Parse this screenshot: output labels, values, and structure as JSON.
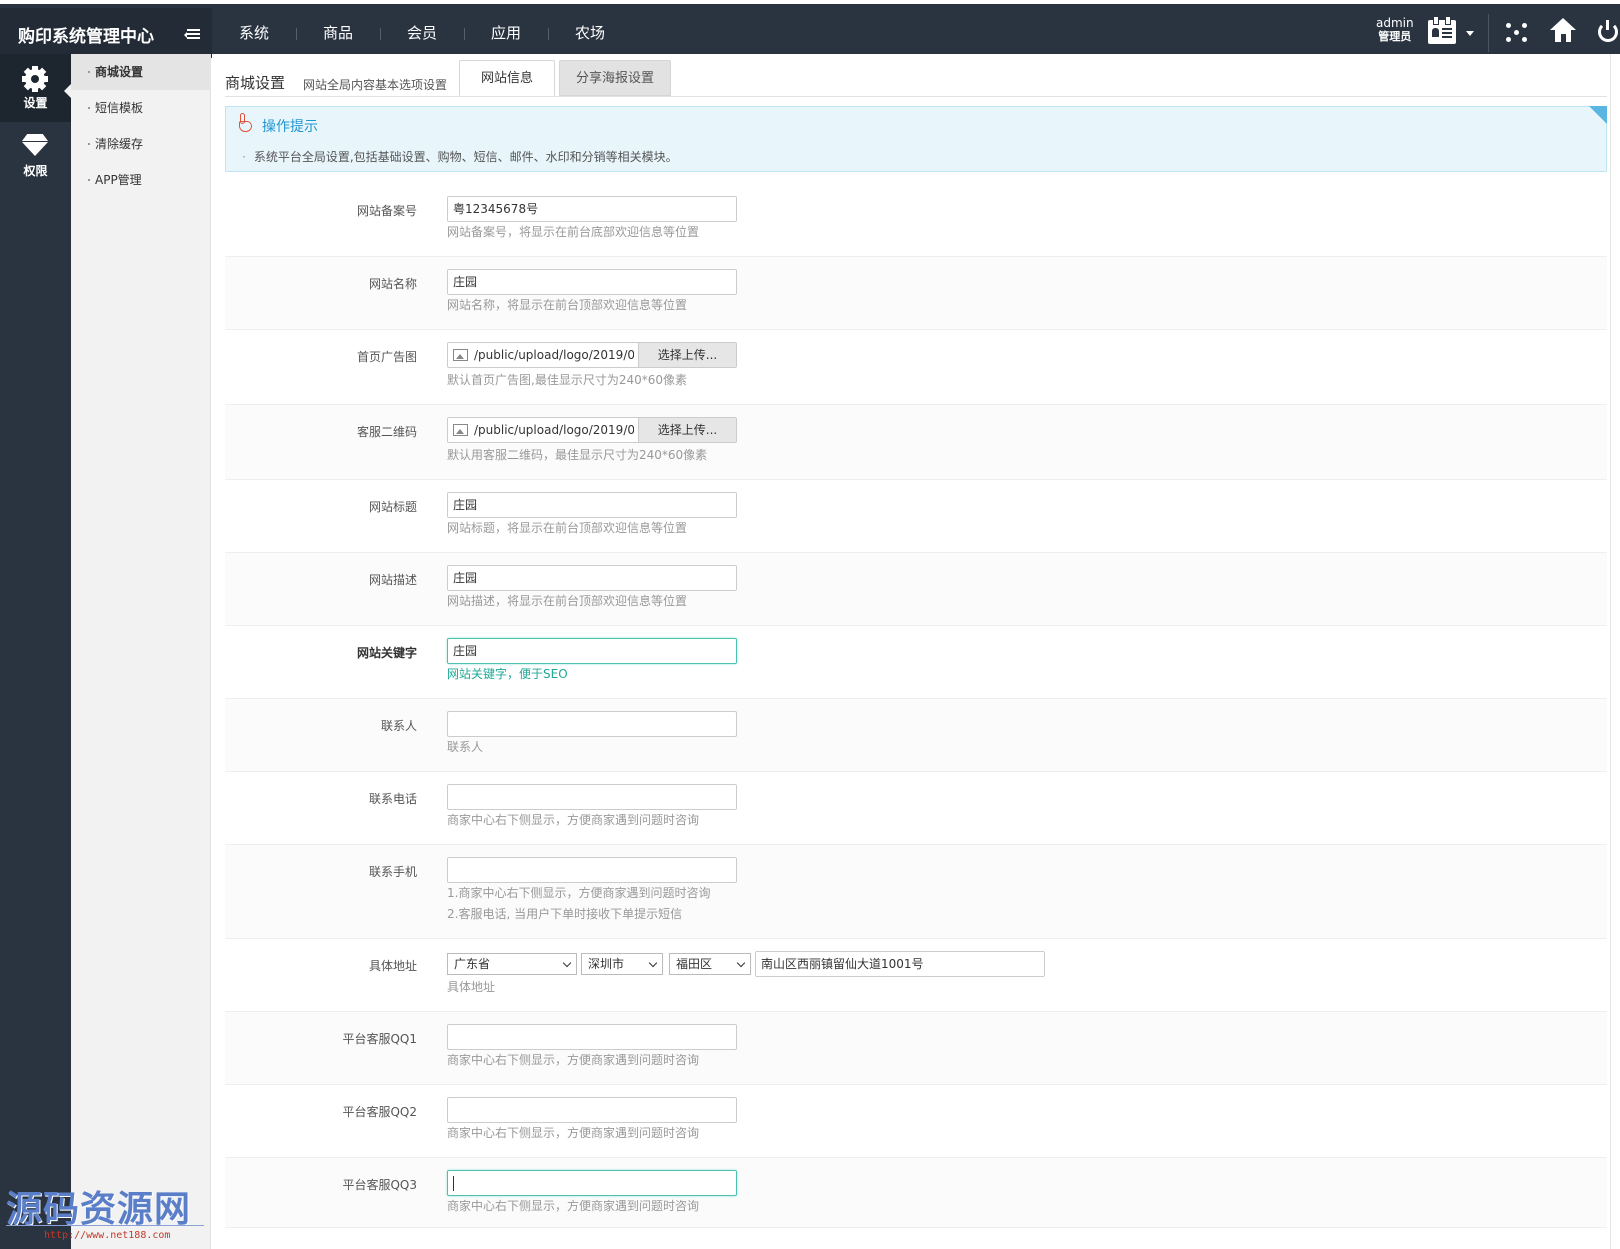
{
  "header": {
    "brand": "购印系统管理中心",
    "nav": [
      "系统",
      "商品",
      "会员",
      "应用",
      "农场"
    ],
    "user_name": "admin",
    "user_role": "管理员"
  },
  "sidebar": {
    "items": [
      {
        "label": "设置",
        "icon": "gear-icon",
        "active": true
      },
      {
        "label": "权限",
        "icon": "diamond-icon",
        "active": false
      }
    ]
  },
  "submenu": {
    "items": [
      "商城设置",
      "短信模板",
      "清除缓存",
      "APP管理"
    ],
    "active": 0
  },
  "page": {
    "title": "商城设置",
    "subtitle": "网站全局内容基本选项设置",
    "tabs": [
      "网站信息",
      "分享海报设置"
    ],
    "active_tab": 0
  },
  "tips": {
    "title": "操作提示",
    "text": "系统平台全局设置,包括基础设置、购物、短信、邮件、水印和分销等相关模块。"
  },
  "form": {
    "icp": {
      "label": "网站备案号",
      "value": "粤12345678号",
      "hint": "网站备案号，将显示在前台底部欢迎信息等位置"
    },
    "site_name": {
      "label": "网站名称",
      "value": "庄园",
      "hint": "网站名称，将显示在前台顶部欢迎信息等位置"
    },
    "home_ad": {
      "label": "首页广告图",
      "value": "/public/upload/logo/2019/0",
      "button": "选择上传...",
      "hint": "默认首页广告图,最佳显示尺寸为240*60像素"
    },
    "qrcode": {
      "label": "客服二维码",
      "value": "/public/upload/logo/2019/0",
      "button": "选择上传...",
      "hint": "默认用客服二维码，最佳显示尺寸为240*60像素"
    },
    "site_title": {
      "label": "网站标题",
      "value": "庄园",
      "hint": "网站标题，将显示在前台顶部欢迎信息等位置"
    },
    "site_desc": {
      "label": "网站描述",
      "value": "庄园",
      "hint": "网站描述，将显示在前台顶部欢迎信息等位置"
    },
    "keywords": {
      "label": "网站关键字",
      "value": "庄园",
      "hint": "网站关键字，便于SEO"
    },
    "contact": {
      "label": "联系人",
      "value": "",
      "hint": "联系人"
    },
    "phone": {
      "label": "联系电话",
      "value": "",
      "hint": "商家中心右下侧显示，方便商家遇到问题时咨询"
    },
    "mobile": {
      "label": "联系手机",
      "value": "",
      "hint1": "1.商家中心右下侧显示，方便商家遇到问题时咨询",
      "hint2": "2.客服电话, 当用户下单时接收下单提示短信"
    },
    "address": {
      "label": "具体地址",
      "province": "广东省",
      "city": "深圳市",
      "district": "福田区",
      "detail": "南山区西丽镇留仙大道1001号",
      "hint": "具体地址"
    },
    "qq1": {
      "label": "平台客服QQ1",
      "value": "",
      "hint": "商家中心右下侧显示，方便商家遇到问题时咨询"
    },
    "qq2": {
      "label": "平台客服QQ2",
      "value": "",
      "hint": "商家中心右下侧显示，方便商家遇到问题时咨询"
    },
    "qq3": {
      "label": "平台客服QQ3",
      "value": "",
      "hint": "商家中心右下侧显示，方便商家遇到问题时咨询"
    }
  },
  "watermark": {
    "text": "源码资源网",
    "url": "http://www.net188.com"
  },
  "colors": {
    "topbar": "#2a3441",
    "accent": "#1fa996",
    "tips_title": "#2196d3"
  }
}
